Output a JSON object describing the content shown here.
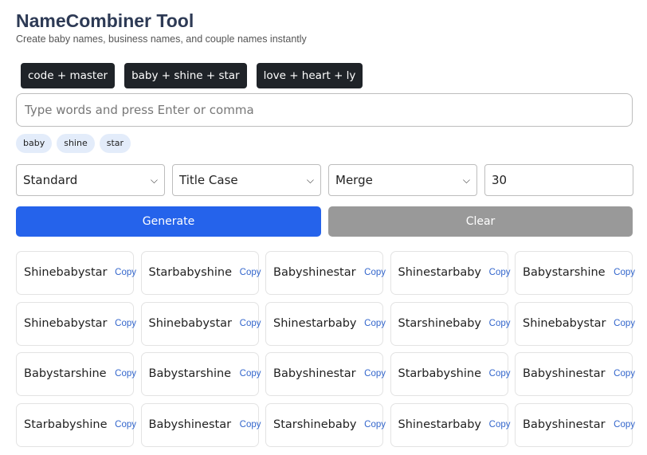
{
  "header": {
    "title": "NameCombiner Tool",
    "subtitle": "Create baby names, business names, and couple names instantly"
  },
  "presets": [
    "code + master",
    "baby + shine + star",
    "love + heart + ly"
  ],
  "word_input": {
    "placeholder": "Type words and press Enter or comma",
    "value": ""
  },
  "tags": [
    "baby",
    "shine",
    "star"
  ],
  "controls": {
    "mode": "Standard",
    "case": "Title Case",
    "method": "Merge",
    "count": "30"
  },
  "buttons": {
    "generate": "Generate",
    "clear": "Clear"
  },
  "copy_label": "Copy",
  "results": [
    "Shinebabystar",
    "Starbabyshine",
    "Babyshinestar",
    "Shinestarbaby",
    "Babystarshine",
    "Shinebabystar",
    "Shinebabystar",
    "Shinestarbaby",
    "Starshinebaby",
    "Shinebabystar",
    "Babystarshine",
    "Babystarshine",
    "Babyshinestar",
    "Starbabyshine",
    "Babyshinestar",
    "Starbabyshine",
    "Babyshinestar",
    "Starshinebaby",
    "Shinestarbaby",
    "Babyshinestar"
  ],
  "icons": {
    "select": "chevron-down-icon"
  },
  "colors": {
    "primary": "#2563eb",
    "secondary": "#999999",
    "title": "#2d3a55",
    "tag_bg": "#e3ecfa"
  }
}
